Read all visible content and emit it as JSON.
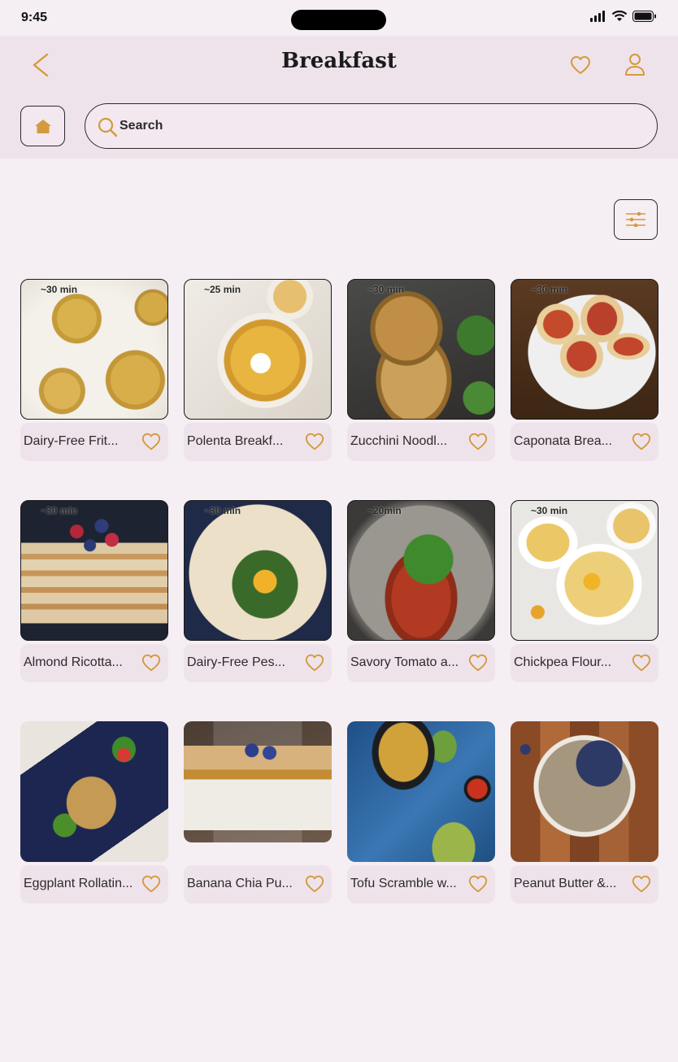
{
  "status": {
    "time": "9:45"
  },
  "header": {
    "title": "Breakfast"
  },
  "search": {
    "placeholder": "Search",
    "value": ""
  },
  "colors": {
    "accent": "#d49a3e",
    "header_bg": "#efe3eb",
    "page_bg": "#f5eef3"
  },
  "recipes": [
    {
      "name": "Dairy-Free Frit...",
      "time": "~30 min",
      "image": "frittata"
    },
    {
      "name": "Polenta Breakf...",
      "time": "~25 min",
      "image": "polenta"
    },
    {
      "name": "Zucchini Noodl...",
      "time": "~30 min",
      "image": "zucchini"
    },
    {
      "name": "Caponata Brea...",
      "time": "~30 min",
      "image": "caponata"
    },
    {
      "name": "Almond Ricotta...",
      "time": "~30 min",
      "image": "pancakes"
    },
    {
      "name": "Dairy-Free Pes...",
      "time": "~30 min",
      "image": "pesto"
    },
    {
      "name": "Savory Tomato a...",
      "time": "~20min",
      "image": "tomato"
    },
    {
      "name": "Chickpea Flour...",
      "time": "~30 min",
      "image": "chickpea"
    },
    {
      "name": "Eggplant Rollatin...",
      "time": "",
      "image": "eggplant"
    },
    {
      "name": "Banana Chia Pu...",
      "time": "",
      "image": "chia"
    },
    {
      "name": "Tofu Scramble w...",
      "time": "",
      "image": "tofu"
    },
    {
      "name": "Peanut Butter &...",
      "time": "",
      "image": "peanut"
    }
  ]
}
